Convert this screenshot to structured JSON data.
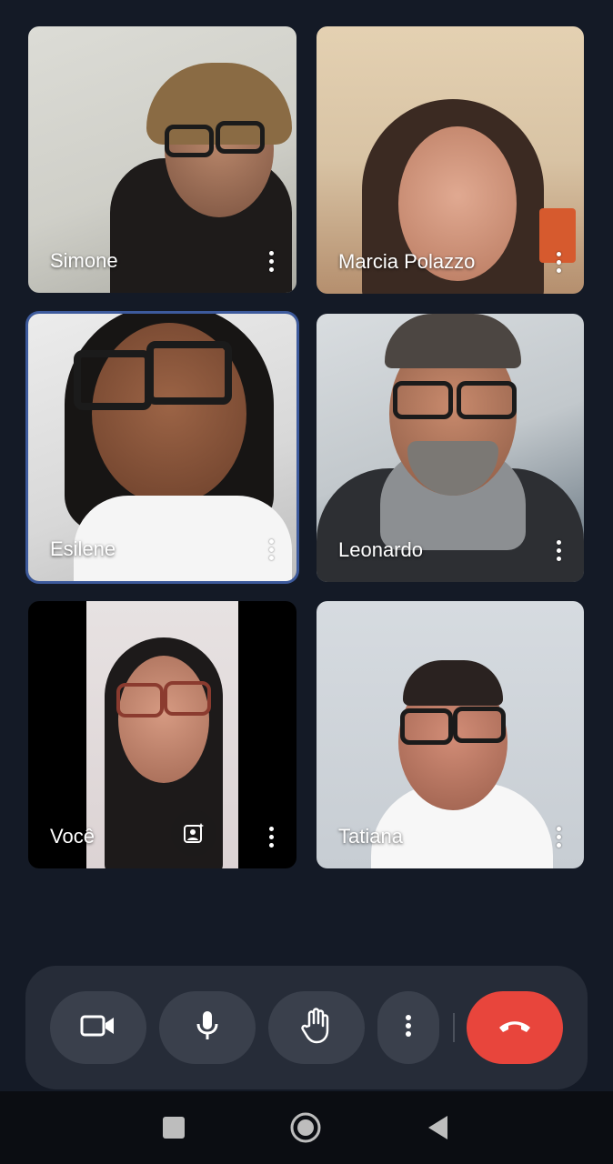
{
  "participants": [
    {
      "name": "Simone"
    },
    {
      "name": "Marcia Polazzo"
    },
    {
      "name": "Esilene"
    },
    {
      "name": "Leonardo"
    },
    {
      "name": "Você"
    },
    {
      "name": "Tatiana"
    }
  ],
  "icons": {
    "camera": "video-camera-icon",
    "mic": "microphone-icon",
    "hand": "raise-hand-icon",
    "more": "more-vertical-icon",
    "end": "end-call-icon",
    "frame": "portrait-sparkle-icon",
    "nav_recent": "square-icon",
    "nav_home": "circle-icon",
    "nav_back": "triangle-back-icon"
  },
  "colors": {
    "background": "#141a26",
    "controls_bar": "#262c38",
    "control_button": "#3a404c",
    "end_call": "#e8453c",
    "active_speaker_border": "#3d5a9c"
  }
}
